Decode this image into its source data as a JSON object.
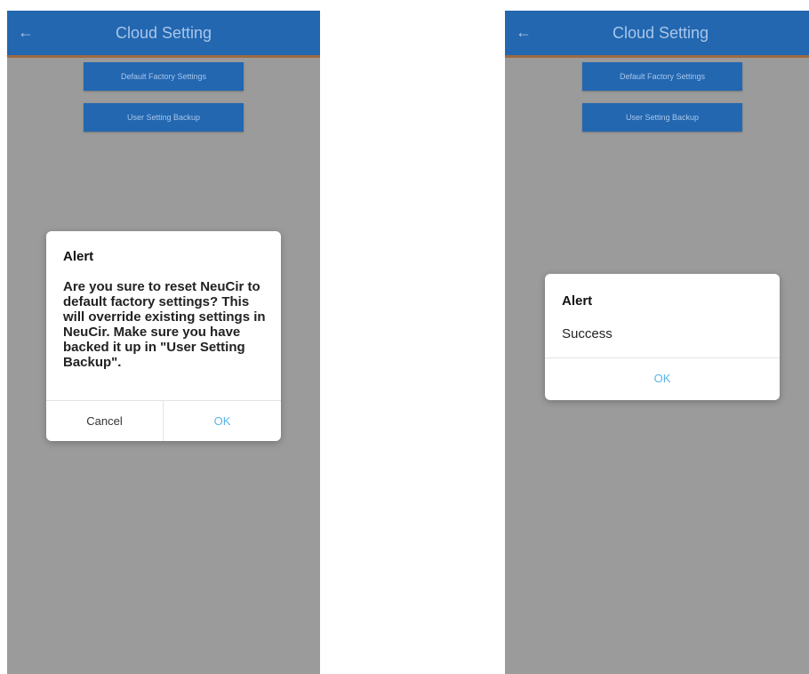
{
  "appbar": {
    "title": "Cloud Setting"
  },
  "buttons": {
    "default_factory": "Default Factory Settings",
    "user_backup": "User Setting Backup"
  },
  "confirm_dialog": {
    "title": "Alert",
    "message": "Are you sure to reset NeuCir to default factory settings? This will override existing settings in NeuCir. Make sure you have backed it up in \"User Setting Backup\".",
    "cancel_label": "Cancel",
    "ok_label": "OK"
  },
  "success_dialog": {
    "title": "Alert",
    "message": "Success",
    "ok_label": "OK"
  },
  "icons": {
    "back": "arrow-left-icon"
  },
  "colors": {
    "primary": "#2267b0",
    "overlay_background": "#9b9b9b",
    "accent_text": "#5ab4e8",
    "dialog_text": "#222222"
  }
}
